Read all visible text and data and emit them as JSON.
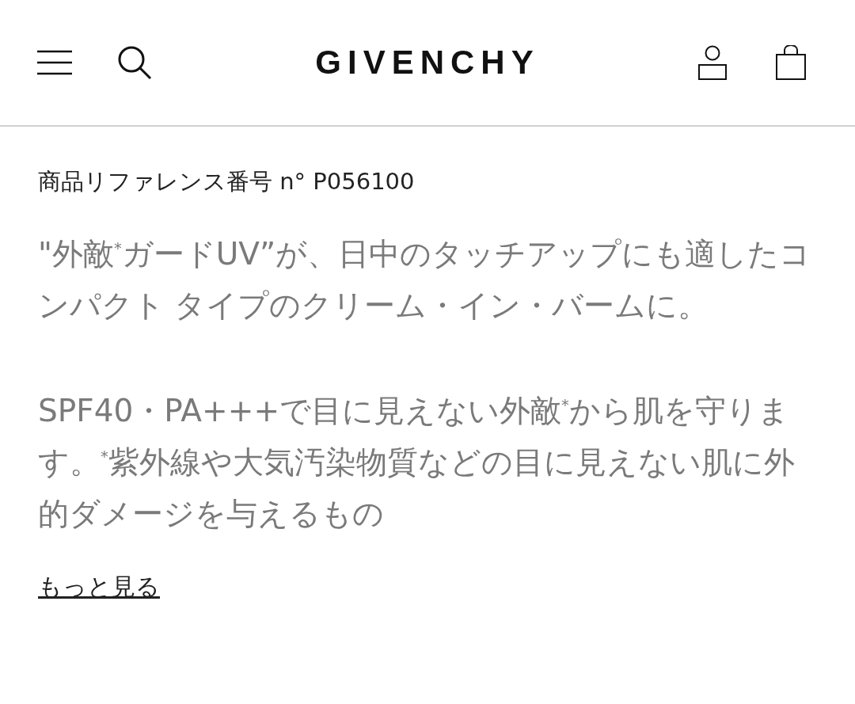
{
  "header": {
    "logo": "GIVENCHY"
  },
  "reference": "商品リファレンス番号 n° P056100",
  "paragraphs": [
    "\"外敵$^{*}$ガードUV”が、日中のタッチアップにも適したコンパクト タイプのクリーム・イン・バームに。",
    "SPF40・PA+++で目に見えない外敵$^{*}$から肌を守ります。$^{*}$紫外線や大気汚染物質などの目に見えない肌に外的ダメージを与えるもの"
  ],
  "more_link": "もっと見る"
}
